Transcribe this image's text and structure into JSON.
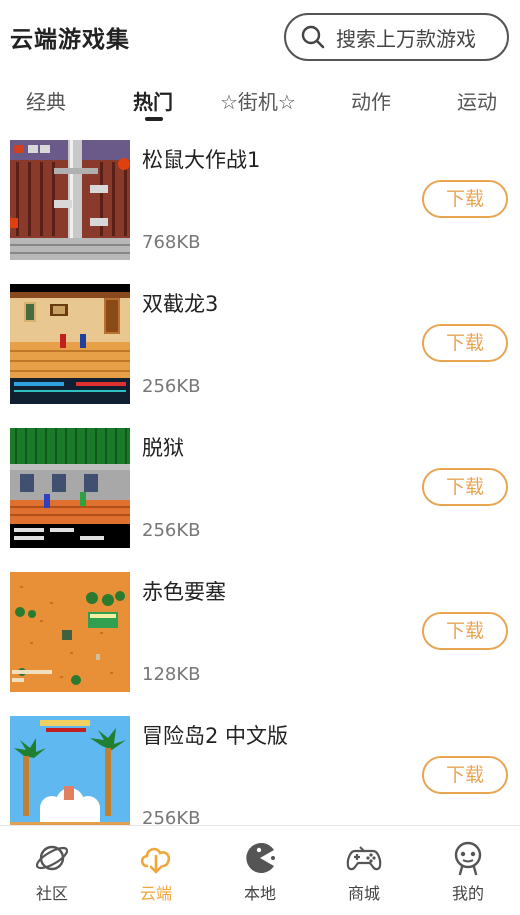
{
  "header": {
    "title": "云端游戏集",
    "search_placeholder": "搜索上万款游戏"
  },
  "tabs": [
    {
      "label": "经典",
      "active": false
    },
    {
      "label": "热门",
      "active": true
    },
    {
      "label": "☆街机☆",
      "active": false
    },
    {
      "label": "动作",
      "active": false
    },
    {
      "label": "运动",
      "active": false
    }
  ],
  "games": [
    {
      "name": "松鼠大作战1",
      "size": "768KB",
      "button": "下载"
    },
    {
      "name": "双截龙3",
      "size": "256KB",
      "button": "下载"
    },
    {
      "name": "脱狱",
      "size": "256KB",
      "button": "下载"
    },
    {
      "name": "赤色要塞",
      "size": "128KB",
      "button": "下载"
    },
    {
      "name": "冒险岛2 中文版",
      "size": "256KB",
      "button": "下载"
    }
  ],
  "bottom_nav": [
    {
      "label": "社区",
      "icon": "planet-icon",
      "active": false
    },
    {
      "label": "云端",
      "icon": "cloud-download-icon",
      "active": true
    },
    {
      "label": "本地",
      "icon": "pacman-icon",
      "active": false
    },
    {
      "label": "商城",
      "icon": "gamepad-icon",
      "active": false
    },
    {
      "label": "我的",
      "icon": "robot-face-icon",
      "active": false
    }
  ],
  "colors": {
    "accent": "#f2a53a",
    "button_border": "#e8a553"
  }
}
